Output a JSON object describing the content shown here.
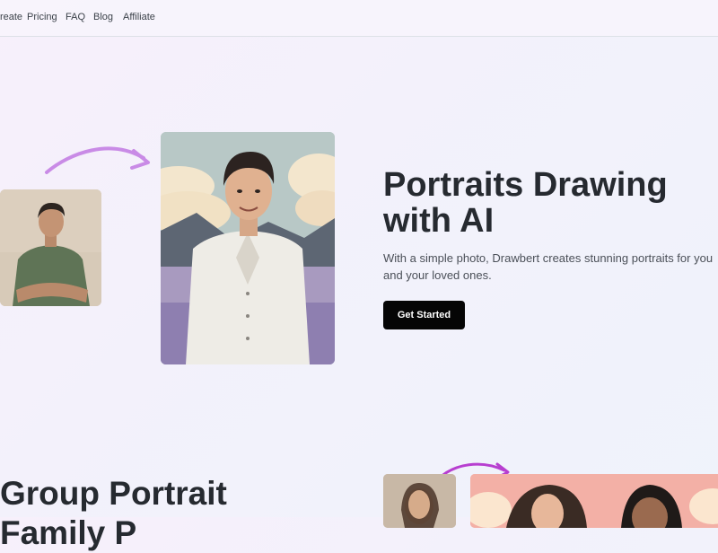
{
  "nav": {
    "items": [
      "Create",
      "Pricing",
      "FAQ",
      "Blog",
      "Affiliate"
    ]
  },
  "hero": {
    "title": "Portraits Drawing with AI",
    "subtitle": "With a simple photo, Drawbert creates stunning portraits for you and your loved ones.",
    "cta_label": "Get Started"
  },
  "section2": {
    "title": "Group Portrait",
    "title_second_line": "Family P"
  },
  "colors": {
    "accent_arrow": "#c98be6",
    "cta_bg": "#050505",
    "heading": "#262a30"
  },
  "icons": [
    "curved-arrow-icon"
  ]
}
